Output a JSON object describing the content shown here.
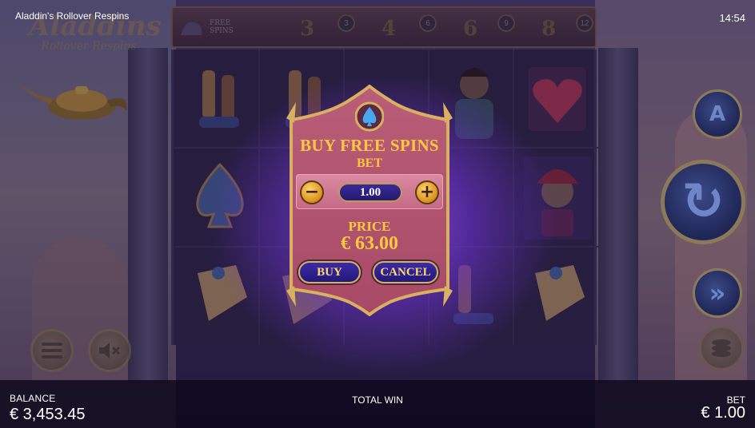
{
  "header": {
    "title": "Aladdin's Rollover Respins",
    "clock": "14:54"
  },
  "logo": {
    "main": "Aladdins",
    "sub": "Rollover Respins"
  },
  "multiplier_strip": {
    "free_spins_label": "FREE SPINS",
    "values": [
      "3",
      "4",
      "6",
      "8"
    ],
    "badges": [
      "3",
      "6",
      "9",
      "12"
    ]
  },
  "dialog": {
    "title": "BUY FREE SPINS",
    "bet_label": "BET",
    "bet_value": "1.00",
    "minus_symbol": "−",
    "plus_symbol": "+",
    "price_label": "PRICE",
    "price_value": "€ 63.00",
    "buy_label": "BUY",
    "cancel_label": "CANCEL"
  },
  "controls": {
    "autoplay_glyph": "A",
    "spin_glyph": "↻",
    "turbo_glyph": "»"
  },
  "bottom_bar": {
    "balance_label": "BALANCE",
    "balance_value": "€ 3,453.45",
    "total_win_label": "TOTAL WIN",
    "bet_label": "BET",
    "bet_value": "€ 1.00"
  },
  "colors": {
    "dialog_gold": "#ffc83c",
    "dialog_panel": "#b5566e",
    "button_blue": "#2b1f8a",
    "glow_purple": "#9650f0"
  }
}
